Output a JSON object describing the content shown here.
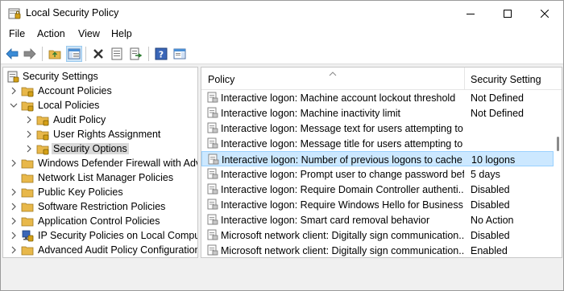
{
  "window": {
    "title": "Local Security Policy"
  },
  "menu": [
    "File",
    "Action",
    "View",
    "Help"
  ],
  "toolbar": {
    "buttons": [
      "back-arrow-icon",
      "forward-arrow-icon",
      "up-folder-icon",
      "show-hide-console-tree-icon",
      "delete-icon",
      "properties-icon",
      "export-list-icon",
      "help-icon",
      "action-pane-icon"
    ]
  },
  "tree": {
    "root": "Security Settings",
    "items": [
      "Account Policies",
      "Local Policies",
      "Audit Policy",
      "User Rights Assignment",
      "Security Options",
      "Windows Defender Firewall with Adva",
      "Network List Manager Policies",
      "Public Key Policies",
      "Software Restriction Policies",
      "Application Control Policies",
      "IP Security Policies on Local Compute",
      "Advanced Audit Policy Configuration"
    ],
    "selected": "Security Options"
  },
  "list": {
    "col_policy": "Policy",
    "col_setting": "Security Setting",
    "rows": [
      {
        "policy": "Interactive logon: Machine account lockout threshold",
        "setting": "Not Defined"
      },
      {
        "policy": "Interactive logon: Machine inactivity limit",
        "setting": "Not Defined"
      },
      {
        "policy": "Interactive logon: Message text for users attempting to ...",
        "setting": ""
      },
      {
        "policy": "Interactive logon: Message title for users attempting to ...",
        "setting": ""
      },
      {
        "policy": "Interactive logon: Number of previous logons to cache ...",
        "setting": "10 logons"
      },
      {
        "policy": "Interactive logon: Prompt user to change password bef...",
        "setting": "5 days"
      },
      {
        "policy": "Interactive logon: Require Domain Controller authenti...",
        "setting": "Disabled"
      },
      {
        "policy": "Interactive logon: Require Windows Hello for Business ...",
        "setting": "Disabled"
      },
      {
        "policy": "Interactive logon: Smart card removal behavior",
        "setting": "No Action"
      },
      {
        "policy": "Microsoft network client: Digitally sign communication...",
        "setting": "Disabled"
      },
      {
        "policy": "Microsoft network client: Digitally sign communication...",
        "setting": "Enabled"
      }
    ],
    "selected_index": 4
  },
  "colors": {
    "selection": "#cce8ff",
    "selection_border": "#99d1ff",
    "folder": "#e8b84a"
  }
}
